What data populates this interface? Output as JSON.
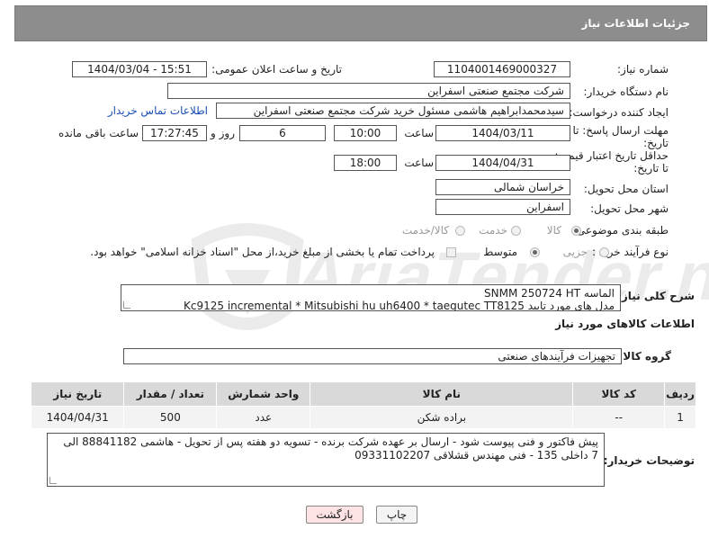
{
  "header": {
    "title": "جزئیات اطلاعات نیاز"
  },
  "form": {
    "need_number_label": "شماره نیاز:",
    "need_number": "1104001469000327",
    "announce_label": "تاریخ و ساعت اعلان عمومی:",
    "announce_value": "1404/03/04 - 15:51",
    "buyer_org_label": "نام دستگاه خریدار:",
    "buyer_org": "شرکت مجتمع صنعتی اسفراین",
    "requester_label": "ایجاد کننده درخواست:",
    "requester": "سیدمحمدابراهیم هاشمی مسئول خرید شرکت مجتمع صنعتی اسفراین",
    "buyer_contact_link": "اطلاعات تماس خریدار",
    "deadline_label_1": "مهلت ارسال پاسخ: تا",
    "deadline_label_2": "تاریخ:",
    "deadline_date": "1404/03/11",
    "time_label": "ساعت",
    "deadline_time": "10:00",
    "days_value": "6",
    "days_label": "روز و",
    "remaining_time": "17:27:45",
    "remaining_label": "ساعت باقی مانده",
    "validity_label_1": "حداقل تاریخ اعتبار قیمت:",
    "validity_label_2": "تا تاریخ:",
    "validity_date": "1404/04/31",
    "validity_time": "18:00",
    "province_label": "استان محل تحویل:",
    "province": "خراسان شمالی",
    "city_label": "شهر محل تحویل:",
    "city": "اسفراین",
    "category_label": "طبقه بندی موضوعی:",
    "category_options": [
      "کالا",
      "خدمت",
      "کالا/خدمت"
    ],
    "process_label": "نوع فرآیند خرید :",
    "process_options": [
      "جزیی",
      "متوسط"
    ],
    "payment_note": "پرداخت تمام یا بخشی از مبلغ خرید،از محل \"اسناد خزانه اسلامی\" خواهد بود."
  },
  "description": {
    "label": "شرح کلی نیاز:",
    "line1": "الماسه SNMM 250724 HT",
    "line2": "مدل های مورد تایید Kc9125 incremental * Mitsubishi hu uh6400 * taegutec TT8125"
  },
  "goods": {
    "section_title": "اطلاعات کالاهای مورد نیاز",
    "group_label": "گروه کالا:",
    "group_value": "تجهیزات فرآیندهای صنعتی",
    "columns": [
      "ردیف",
      "کد کالا",
      "نام کالا",
      "واحد شمارش",
      "تعداد / مقدار",
      "تاریخ نیاز"
    ],
    "rows": [
      [
        "1",
        "--",
        "براده شکن",
        "عدد",
        "500",
        "1404/04/31"
      ]
    ]
  },
  "buyer_notes": {
    "label": "توضیحات خریدار:",
    "text": "پیش فاکتور و فنی پیوست شود - ارسال بر عهده شرکت برنده - تسویه دو هفته پس از تحویل - هاشمی 88841182 الی 7 داخلی 135 - فنی مهندس قشلاقی 09331102207"
  },
  "buttons": {
    "print": "چاپ",
    "back": "بازگشت"
  },
  "watermark": {
    "text": "AriaTender.neT"
  },
  "colors": {
    "header_bg": "#8d8d8d",
    "link": "#1a4fb5",
    "back_btn_bg": "#fde3e3"
  }
}
